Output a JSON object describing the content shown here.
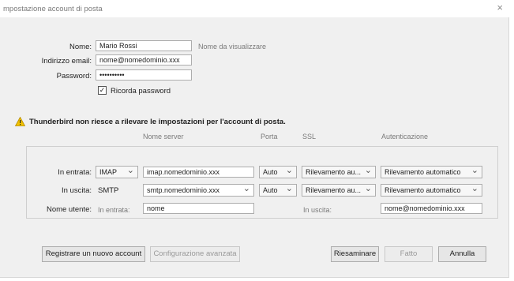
{
  "window": {
    "title": "mpostazione account di posta",
    "close_glyph": "×"
  },
  "identity": {
    "name_label": "Nome:",
    "name_value": "Mario Rossi",
    "name_hint": "Nome da visualizzare",
    "email_label": "Indirizzo email:",
    "email_value": "nome@nomedominio.xxx",
    "password_label": "Password:",
    "password_value": "••••••••••",
    "remember_label": "Ricorda password",
    "remember_checked": true
  },
  "warning": {
    "icon": "warning-triangle-icon",
    "text": "Thunderbird non riesce a rilevare le impostazioni per l'account di posta."
  },
  "server_settings": {
    "headers": {
      "server_name": "Nome server",
      "port": "Porta",
      "ssl": "SSL",
      "auth": "Autenticazione"
    },
    "incoming": {
      "label": "In entrata:",
      "protocol": "IMAP",
      "server": "imap.nomedominio.xxx",
      "port": "Auto",
      "ssl": "Rilevamento au...",
      "auth": "Rilevamento automatico"
    },
    "outgoing": {
      "label": "In uscita:",
      "protocol": "SMTP",
      "server": "smtp.nomedominio.xxx",
      "port": "Auto",
      "ssl": "Rilevamento au...",
      "auth": "Rilevamento automatico"
    },
    "username": {
      "label": "Nome utente:",
      "incoming_label": "In entrata:",
      "incoming_value": "nome",
      "outgoing_label": "In uscita:",
      "outgoing_value": "nome@nomedominio.xxx"
    }
  },
  "buttons": {
    "register": "Registrare un nuovo account",
    "advanced": "Configurazione avanzata",
    "retest": "Riesaminare",
    "done": "Fatto",
    "cancel": "Annulla"
  },
  "colors": {
    "window_bg": "#f0f0f0",
    "warning": "#f2c200"
  }
}
